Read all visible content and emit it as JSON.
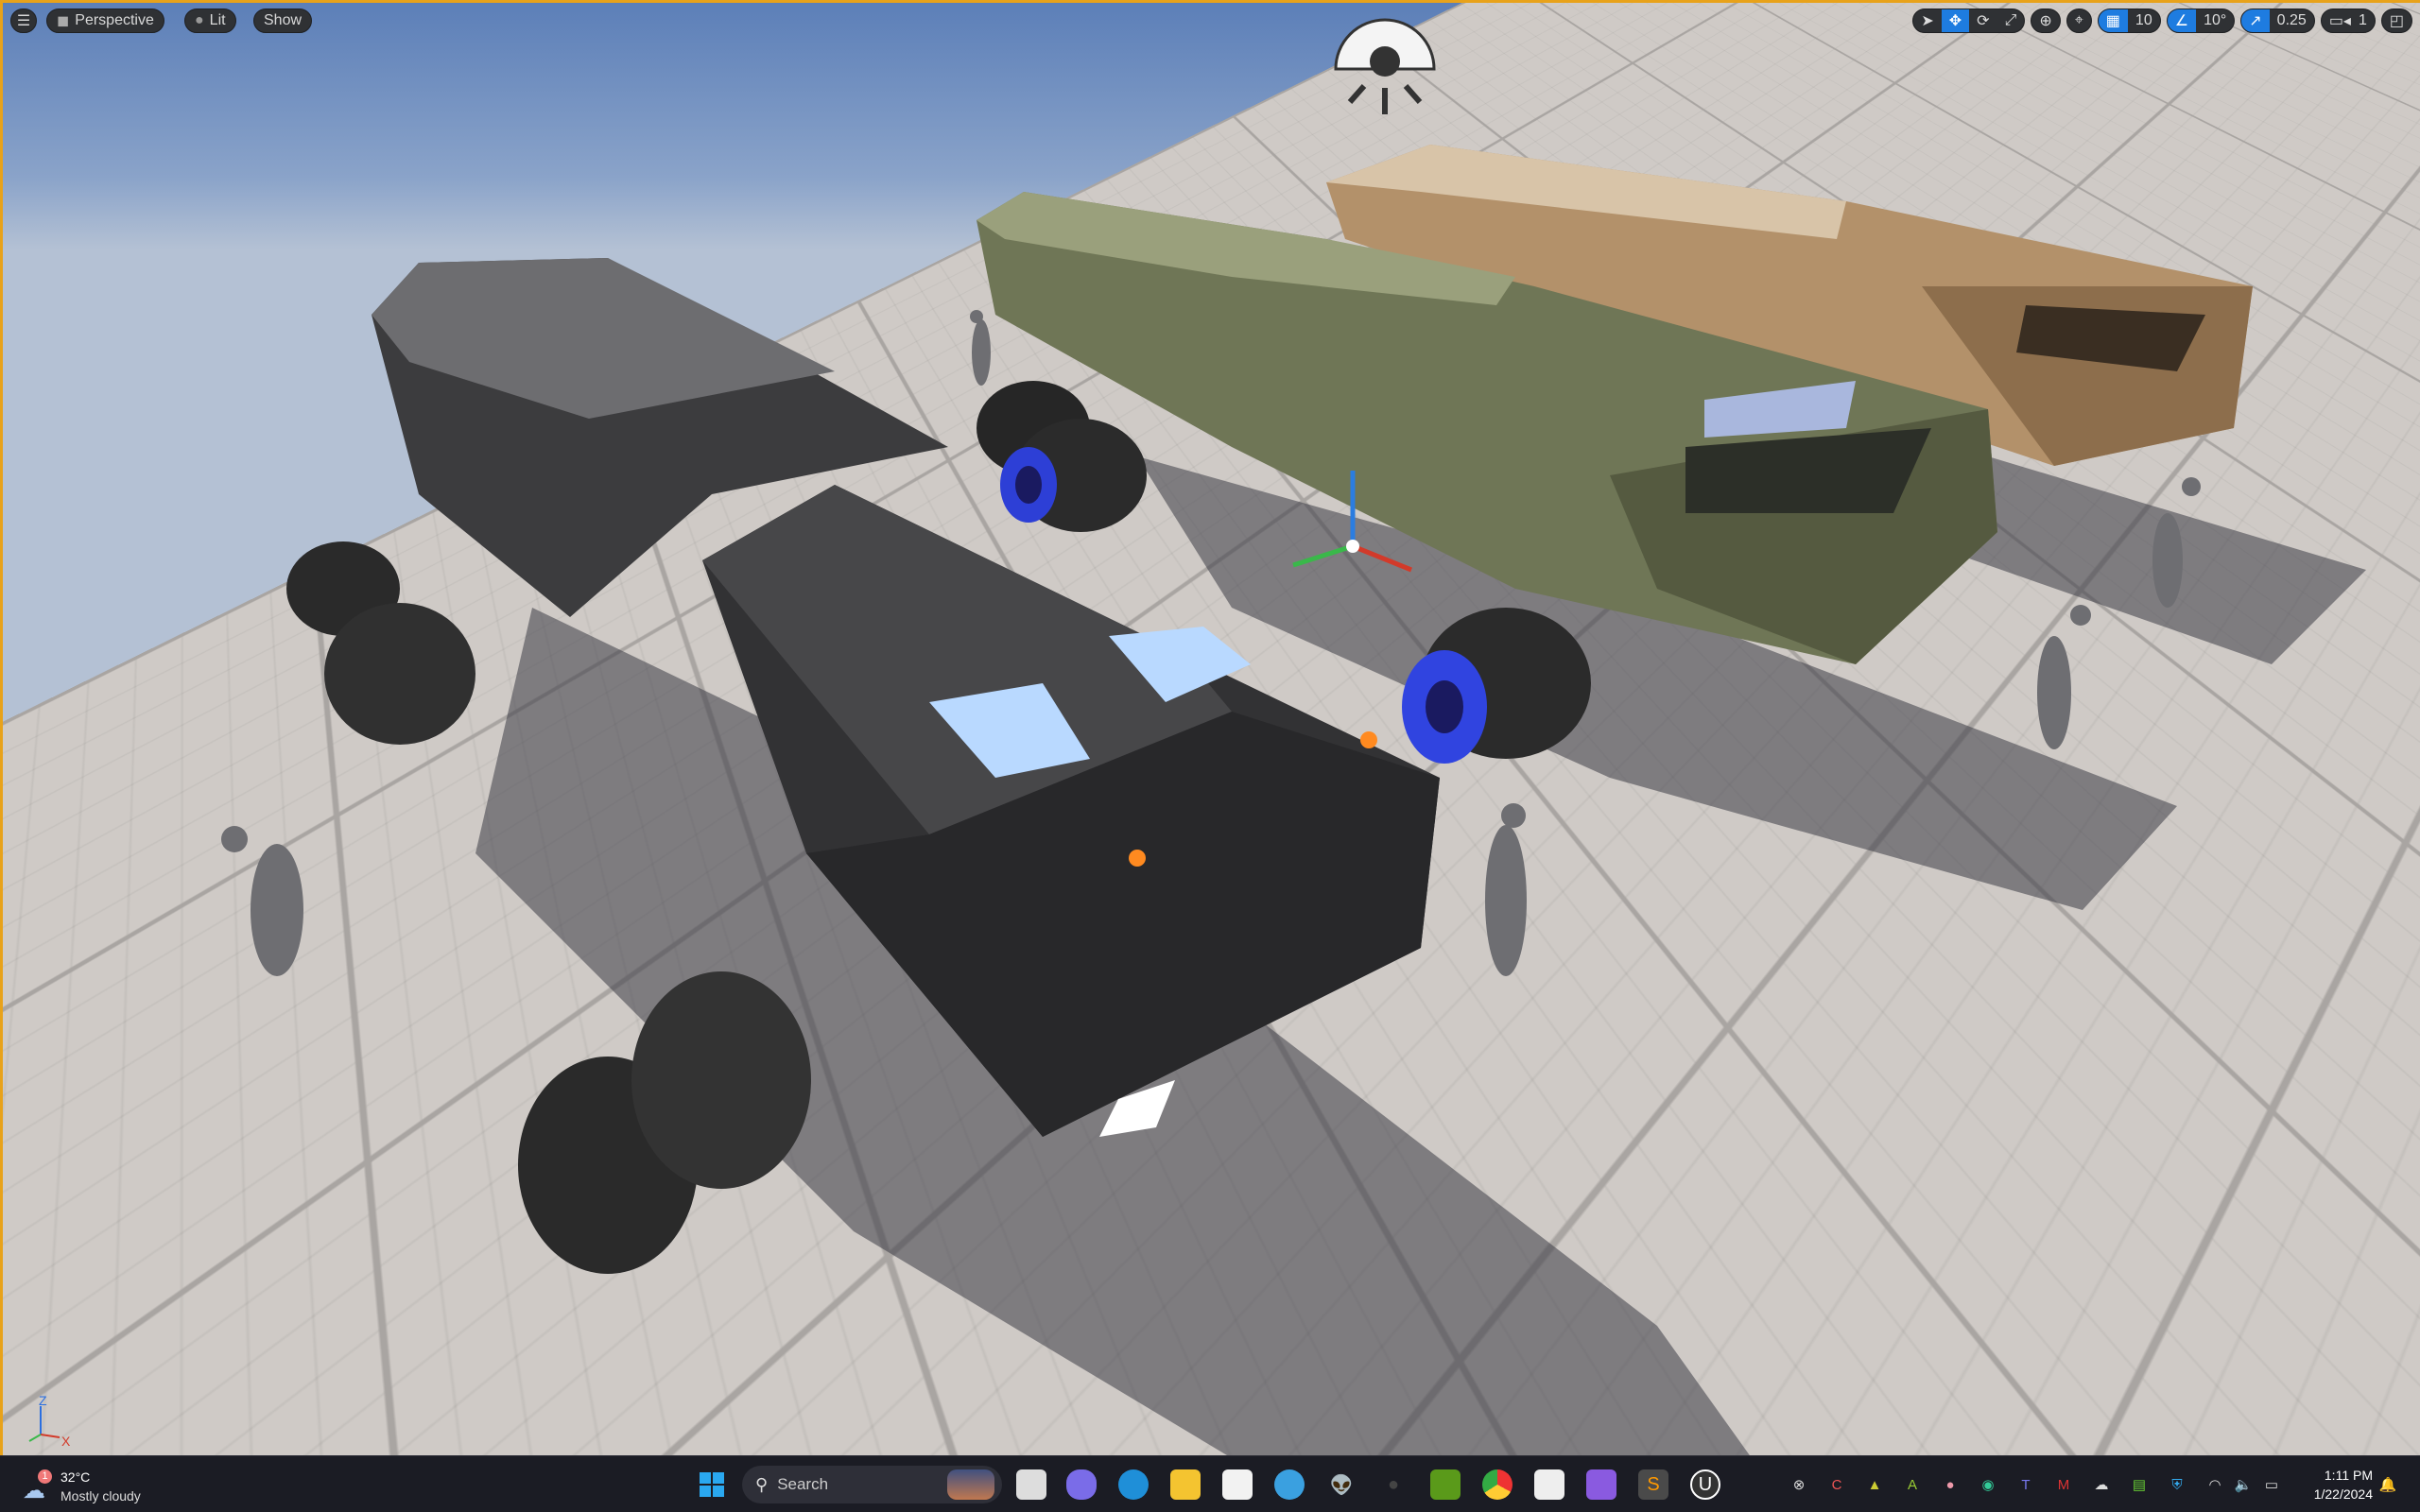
{
  "viewport": {
    "menu_icon": "hamburger-icon",
    "perspective_label": "Perspective",
    "lit_label": "Lit",
    "show_label": "Show",
    "grid_snap": "10",
    "rotation_snap": "10°",
    "scale_snap": "0.25",
    "camera_speed": "1",
    "axis": {
      "x": "X",
      "y": "Y",
      "z": "Z"
    }
  },
  "accent": "#1e7ce0",
  "border_color": "#e8a21a",
  "taskbar": {
    "weather_temp": "32°C",
    "weather_desc": "Mostly cloudy",
    "weather_badge": "1",
    "search_placeholder": "Search",
    "time": "1:11 PM",
    "date": "1/22/2024",
    "apps": [
      "task-view",
      "meet",
      "edge",
      "file-explorer",
      "store",
      "paint",
      "alienware",
      "alienware-dark",
      "nvidia",
      "chrome",
      "snipping-tool",
      "clipchamp",
      "sublime",
      "unreal-engine"
    ],
    "tray": [
      "xbox",
      "ccleaner",
      "tray-app",
      "font-app",
      "tray-app-2",
      "tray-app-3",
      "teams",
      "mcafee",
      "onedrive",
      "memory",
      "defender",
      "wifi",
      "volume",
      "battery"
    ]
  }
}
